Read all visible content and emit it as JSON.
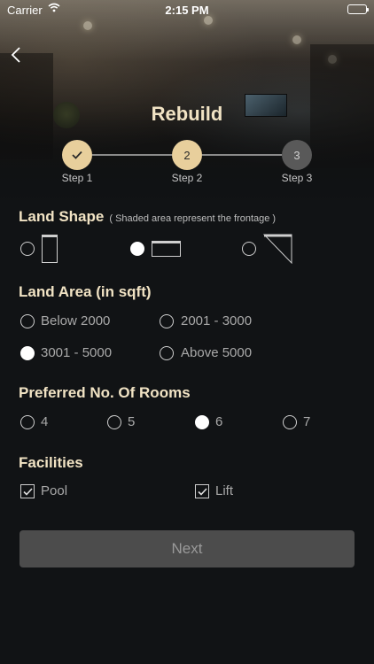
{
  "status_bar": {
    "carrier": "Carrier",
    "time": "2:15 PM"
  },
  "header": {
    "title": "Rebuild",
    "back_icon": "chevron-left-icon"
  },
  "stepper": {
    "steps": [
      {
        "label": "Step 1",
        "state": "done",
        "value": "✓"
      },
      {
        "label": "Step 2",
        "state": "active",
        "value": "2"
      },
      {
        "label": "Step 3",
        "state": "pending",
        "value": "3"
      }
    ]
  },
  "land_shape": {
    "title": "Land Shape",
    "note": "( Shaded area represent the frontage )",
    "selected_index": 1,
    "options": [
      "tall-rectangle-icon",
      "wide-rectangle-icon",
      "triangle-icon"
    ]
  },
  "land_area": {
    "title": "Land Area (in sqft)",
    "options": [
      "Below 2000",
      "2001 - 3000",
      "3001 - 5000",
      "Above 5000"
    ],
    "selected_index": 2
  },
  "rooms": {
    "title": "Preferred No. Of Rooms",
    "options": [
      "4",
      "5",
      "6",
      "7"
    ],
    "selected_index": 2
  },
  "facilities": {
    "title": "Facilities",
    "options": [
      {
        "label": "Pool",
        "checked": true
      },
      {
        "label": "Lift",
        "checked": true
      }
    ]
  },
  "next_button": {
    "label": "Next"
  },
  "colors": {
    "accent": "#e8cf9c",
    "heading": "#f1e3c4",
    "background": "#111315",
    "button": "#4c4c4c"
  }
}
